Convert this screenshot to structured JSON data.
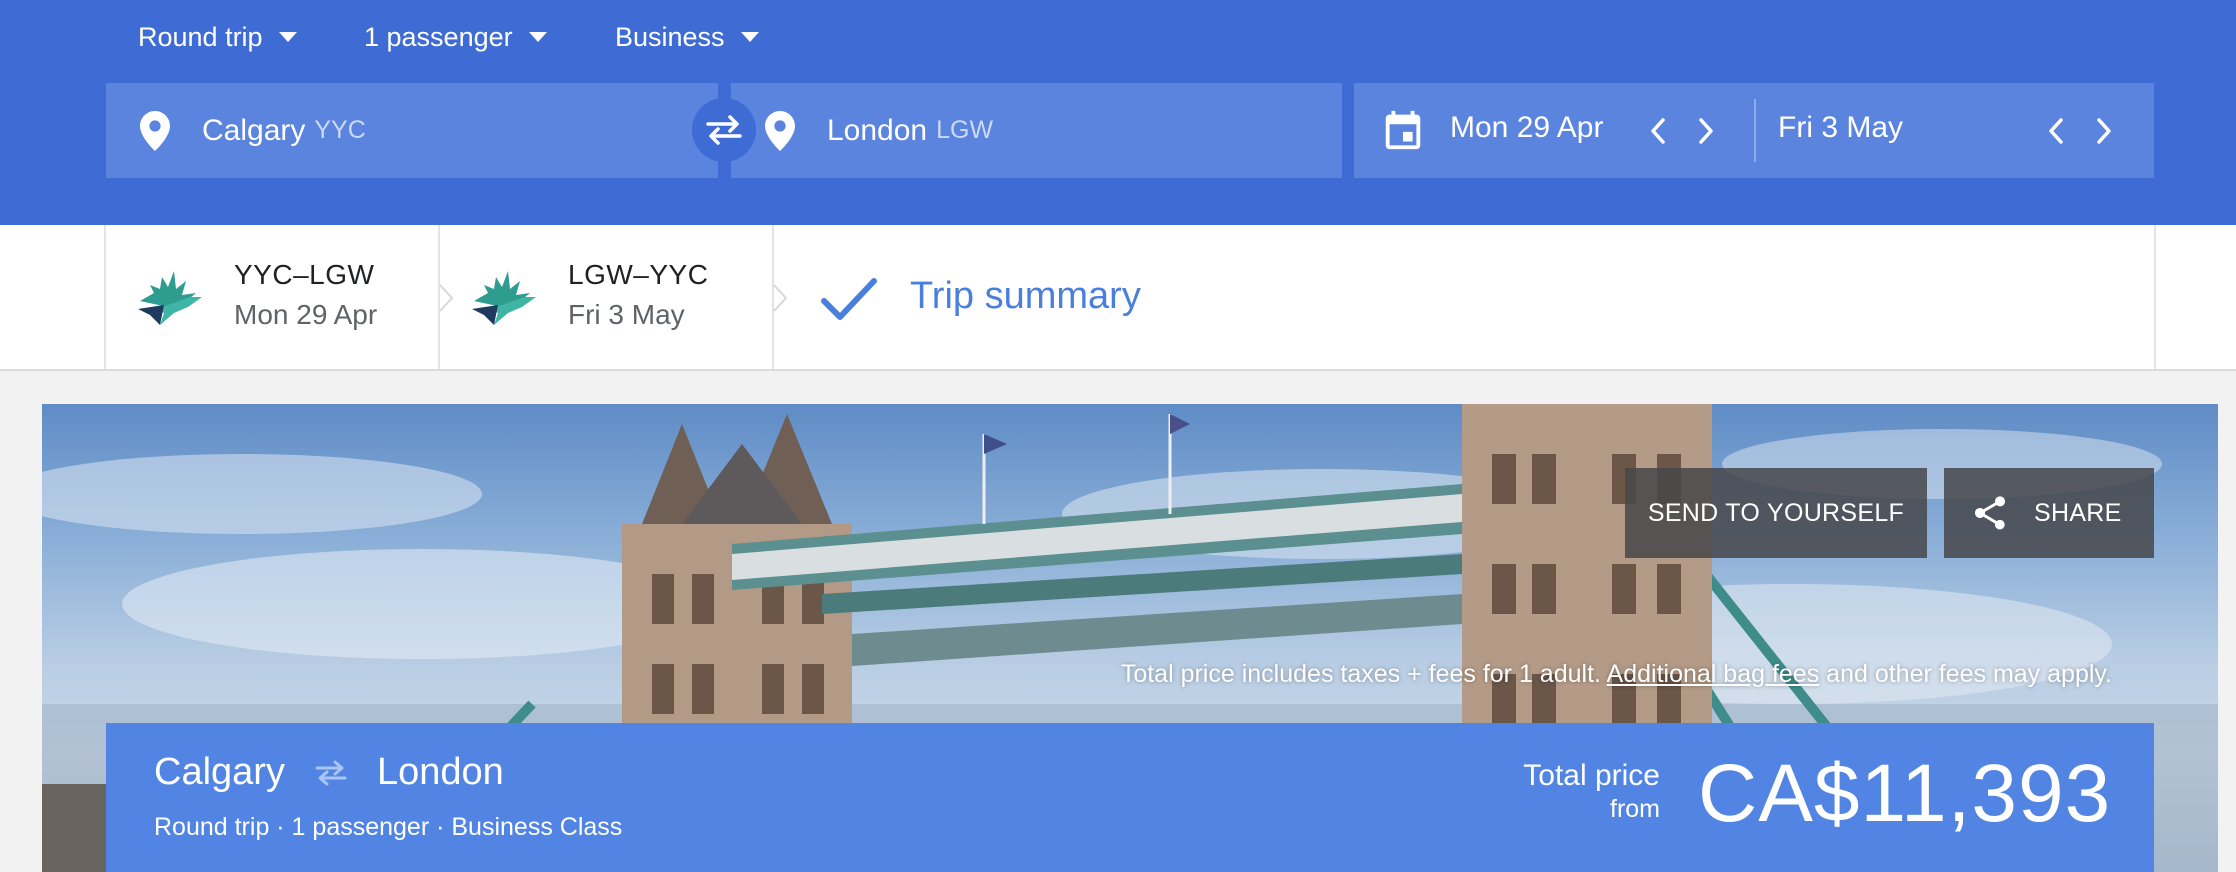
{
  "search": {
    "trip_type": "Round trip",
    "passengers": "1 passenger",
    "cabin": "Business",
    "origin": {
      "city": "Calgary",
      "code": "YYC"
    },
    "destination": {
      "city": "London",
      "code": "LGW"
    },
    "depart_date": "Mon 29 Apr",
    "return_date": "Fri 3 May"
  },
  "steps": [
    {
      "route": "YYC–LGW",
      "date": "Mon 29 Apr"
    },
    {
      "route": "LGW–YYC",
      "date": "Fri 3 May"
    }
  ],
  "summary_label": "Trip summary",
  "hero": {
    "send_label": "SEND TO YOURSELF",
    "share_label": "SHARE",
    "note_prefix": "Total price includes taxes + fees for 1 adult.",
    "note_link": "Additional bag fees",
    "note_suffix": "and other fees may apply."
  },
  "price_card": {
    "origin": "Calgary",
    "destination": "London",
    "details": "Round trip · 1 passenger · Business Class",
    "total_label": "Total price",
    "from_label": "from",
    "amount": "CA$11,393"
  },
  "colors": {
    "header_blue": "#3e6bd4",
    "field_blue": "#5b84df",
    "accent_blue": "#4a7fdc",
    "card_blue": "#5285e3"
  },
  "icons": {
    "place": "place-icon",
    "swap": "swap-icon",
    "calendar": "calendar-icon",
    "check": "check-icon",
    "share": "share-icon",
    "airline": "westjet-logo-icon"
  }
}
